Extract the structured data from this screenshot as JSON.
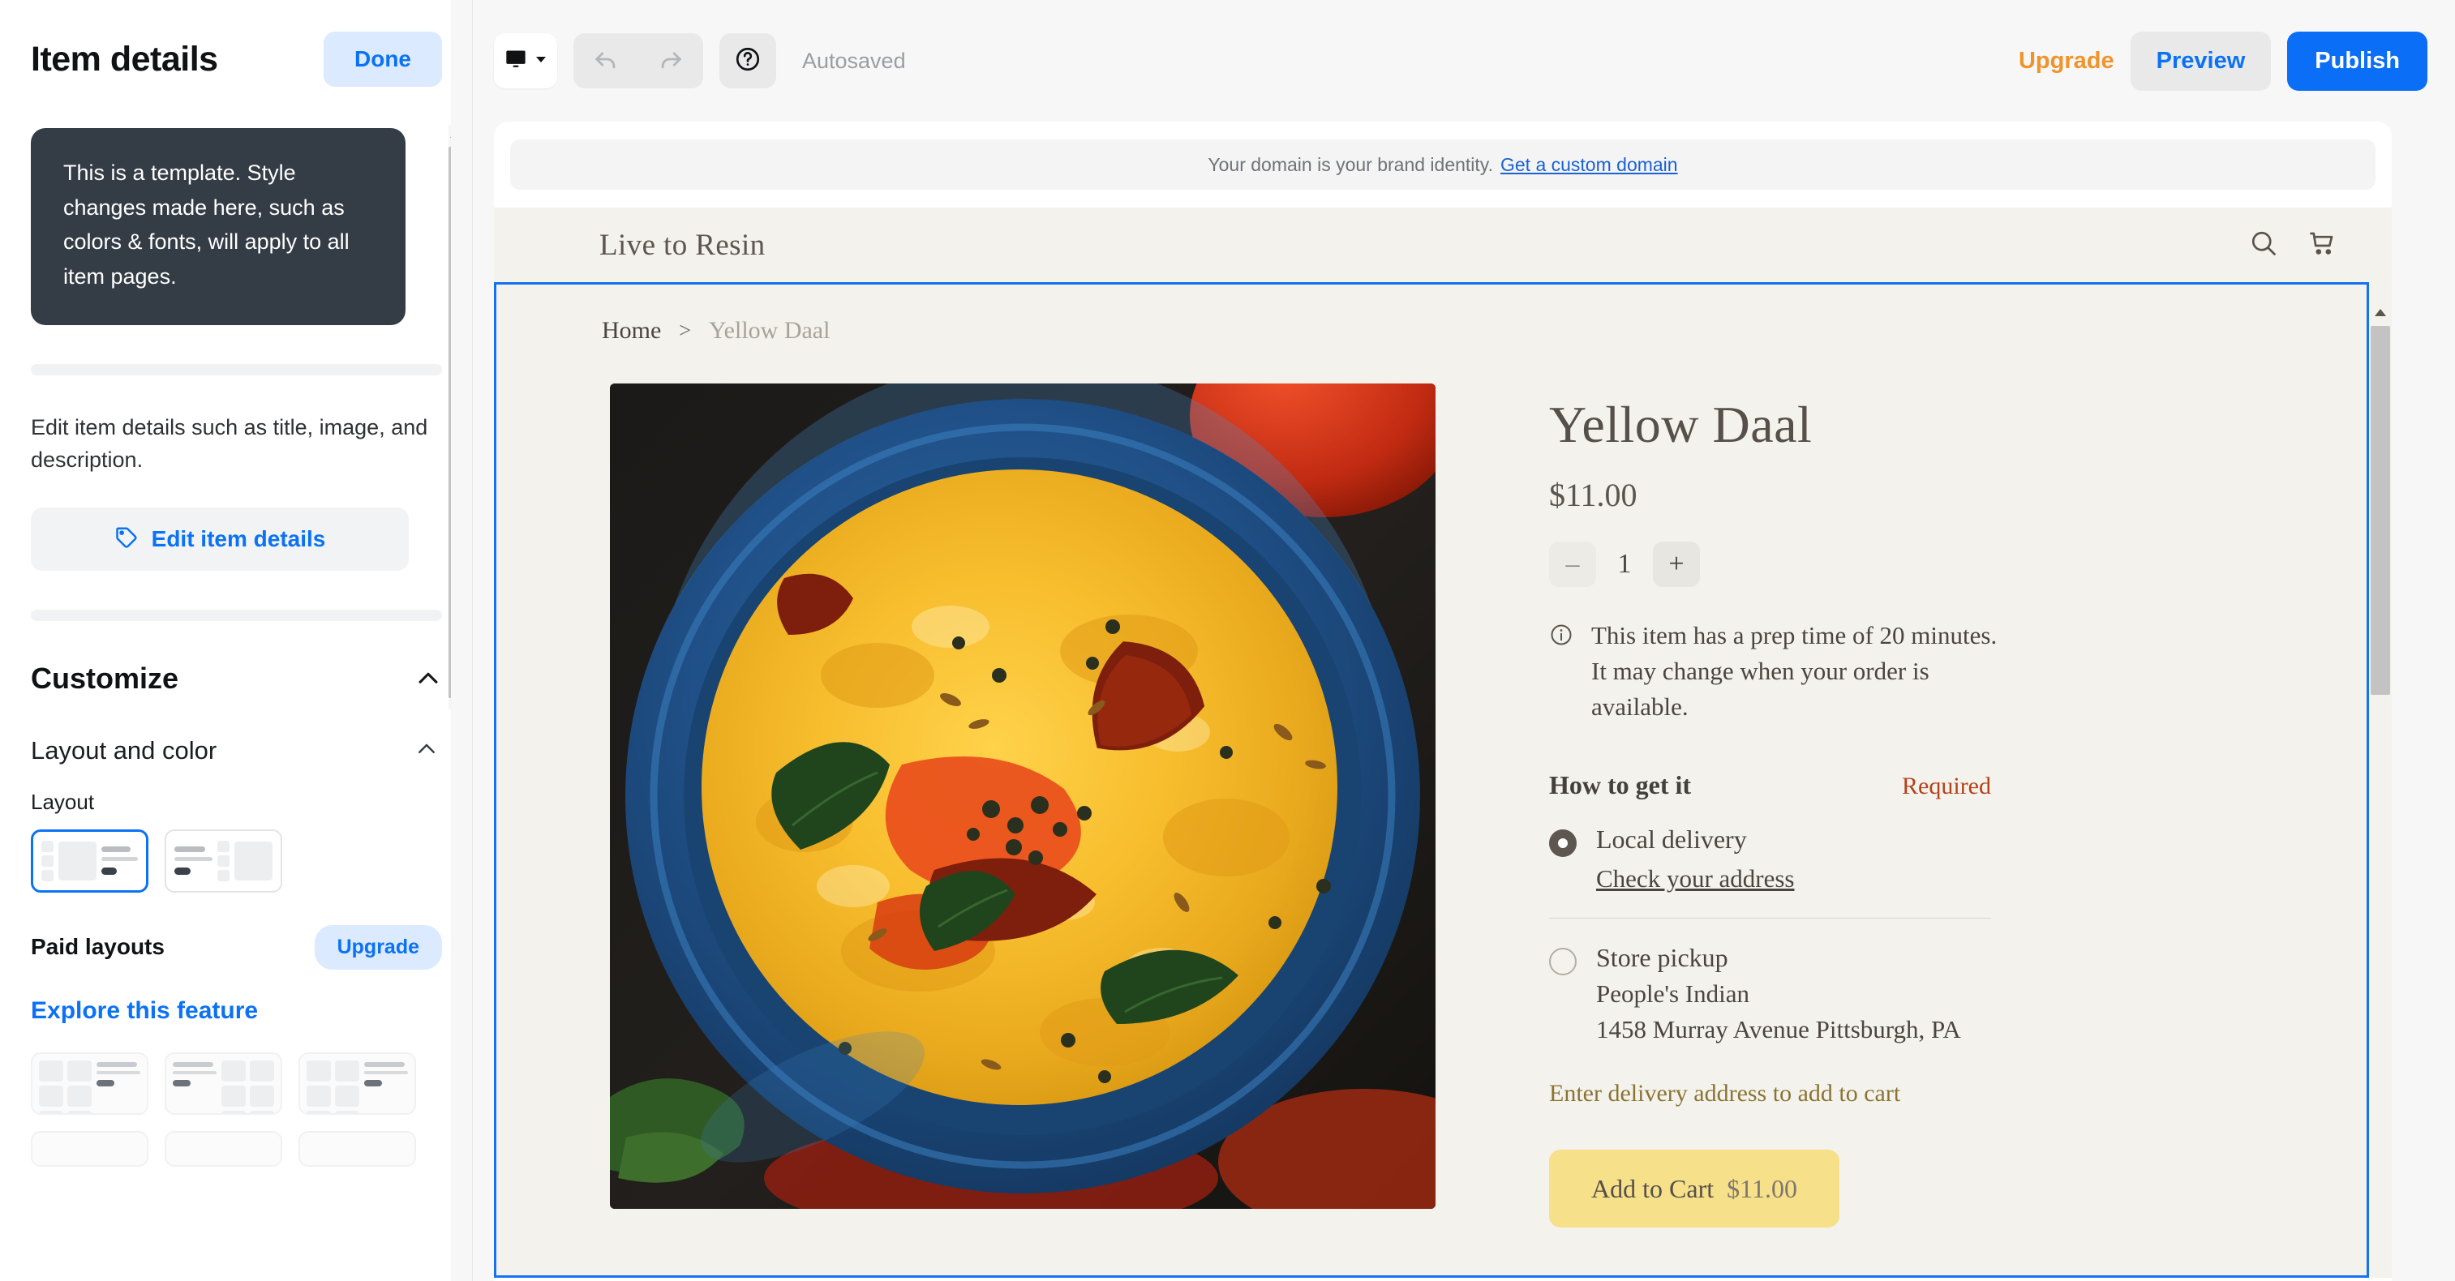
{
  "sidebar": {
    "title": "Item details",
    "done_label": "Done",
    "tip": "This is a template. Style changes made here, such as colors & fonts, will apply to all item pages.",
    "description": "Edit item details such as title, image, and description.",
    "edit_button": "Edit item details",
    "customize_label": "Customize",
    "layout_color_label": "Layout and color",
    "layout_field_label": "Layout",
    "paid_layouts_label": "Paid layouts",
    "upgrade_pill_label": "Upgrade",
    "explore_label": "Explore this feature"
  },
  "toolbar": {
    "autosaved_label": "Autosaved",
    "upgrade_label": "Upgrade",
    "preview_label": "Preview",
    "publish_label": "Publish",
    "device_icon": "desktop-monitor-icon",
    "undo_icon": "undo-arrow-icon",
    "redo_icon": "redo-arrow-icon",
    "help_icon": "question-mark-circle-icon"
  },
  "canvas": {
    "domain_banner_text": "Your domain is your brand identity.",
    "domain_banner_link": "Get a custom domain",
    "brand_name": "Live to Resin",
    "search_icon": "search-icon",
    "cart_icon": "shopping-cart-icon"
  },
  "product": {
    "breadcrumb_home": "Home",
    "breadcrumb_sep": ">",
    "breadcrumb_current": "Yellow Daal",
    "title": "Yellow Daal",
    "price": "$11.00",
    "qty_minus": "–",
    "qty_value": "1",
    "qty_plus": "+",
    "prep_note": "This item has a prep time of 20 minutes. It may change when your order is available.",
    "how_to_get_it": "How to get it",
    "required_label": "Required",
    "fulfillment": [
      {
        "name": "Local delivery",
        "selected": true,
        "link": "Check your address"
      },
      {
        "name": "Store pickup",
        "selected": false,
        "store_name": "People's Indian",
        "store_address": "1458 Murray Avenue Pittsburgh, PA"
      }
    ],
    "delivery_warning": "Enter delivery address to add to cart",
    "add_to_cart_label": "Add to Cart",
    "add_to_cart_price": "$11.00",
    "image_alt": "yellow-daal-bowl-photo"
  },
  "colors": {
    "accent_blue": "#0b6ef6",
    "upgrade_orange": "#f0932b",
    "required_red": "#b5401a",
    "warning_gold": "#8a7433",
    "cart_yellow": "#f7e08a",
    "site_bg": "#f4f2ec",
    "tip_bg": "#343c46"
  }
}
